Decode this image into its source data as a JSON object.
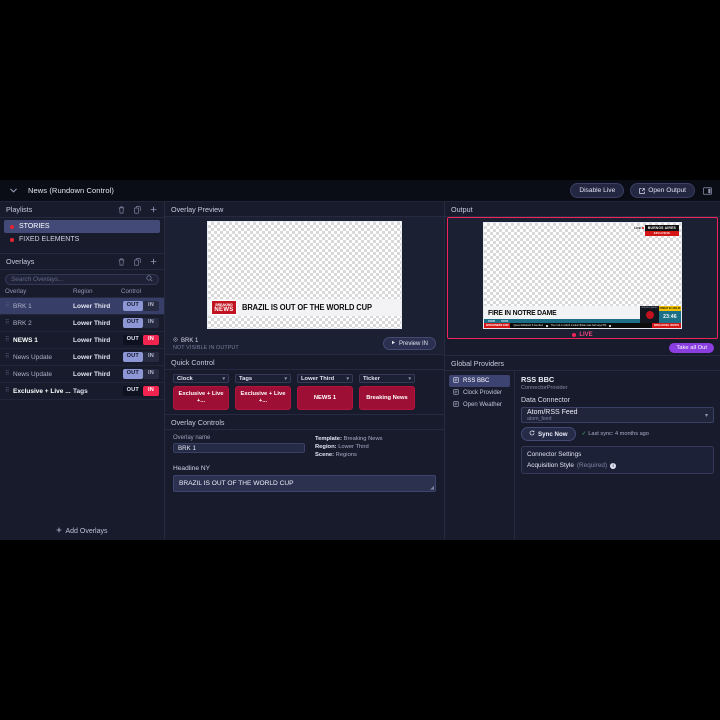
{
  "topbar": {
    "title": "News (Rundown Control)",
    "collapse_icon": "chevron-down-icon",
    "disable_live_label": "Disable Live",
    "open_output_label": "Open Output",
    "open_output_icon": "external-link-icon",
    "layout_icon": "panel-layout-icon"
  },
  "playlists": {
    "title": "Playlists",
    "actions": [
      "trash-icon",
      "duplicate-icon",
      "plus-icon"
    ],
    "items": [
      {
        "label": "STORIES",
        "active": true
      },
      {
        "label": "FIXED ELEMENTS",
        "active": false
      }
    ]
  },
  "overlays": {
    "title": "Overlays",
    "actions": [
      "trash-icon",
      "duplicate-icon",
      "plus-icon"
    ],
    "search_placeholder": "Search Overlays...",
    "search_value": "",
    "search_icon": "search-icon",
    "columns": [
      "Overlay",
      "Region",
      "Control"
    ],
    "out_label": "OUT",
    "in_label": "IN",
    "rows": [
      {
        "name": "BRK 1",
        "region": "Lower Third",
        "state": "out",
        "selected": true,
        "bold": false
      },
      {
        "name": "BRK 2",
        "region": "Lower Third",
        "state": "out",
        "selected": false,
        "bold": false
      },
      {
        "name": "NEWS 1",
        "region": "Lower Third",
        "state": "in",
        "selected": false,
        "bold": true
      },
      {
        "name": "News Update",
        "region": "Lower Third",
        "state": "out",
        "selected": false,
        "bold": false
      },
      {
        "name": "News Update",
        "region": "Lower Third",
        "state": "out",
        "selected": false,
        "bold": false
      },
      {
        "name": "Exclusive + Live ...",
        "region": "Tags",
        "state": "in",
        "selected": false,
        "bold": true
      }
    ],
    "add_label": "Add Overlays",
    "add_icon": "plus-icon"
  },
  "preview": {
    "title": "Overlay Preview",
    "overlay_name": "BRK 1",
    "name_icon": "target-icon",
    "status": "NOT VISIBLE IN OUTPUT",
    "button_label": "Preview IN",
    "button_icon": "play-icon",
    "graphic": {
      "badge_top": "BREAKING",
      "badge_bottom": "NEWS",
      "headline": "BRAZIL IS OUT OF THE WORLD CUP"
    }
  },
  "quick_control": {
    "title": "Quick Control",
    "chevron_icon": "chevron-down-icon",
    "columns": [
      {
        "select": "Clock",
        "button": "Exclusive + Live +..."
      },
      {
        "select": "Tags",
        "button": "Exclusive + Live +..."
      },
      {
        "select": "Lower Third",
        "button": "NEWS 1"
      },
      {
        "select": "Ticker",
        "button": "Breaking News"
      }
    ]
  },
  "overlay_controls": {
    "title": "Overlay Controls",
    "name_label": "Overlay name",
    "name_value": "BRK 1",
    "meta": {
      "template_key": "Template:",
      "template_value": "Breaking News",
      "region_key": "Region:",
      "region_value": "Lower Third",
      "scene_key": "Scene:",
      "scene_value": "Regions"
    },
    "headline_label": "Headline NY",
    "headline_value": "BRAZIL IS OUT OF THE WORLD CUP",
    "resize_icon": "resize-grip-icon"
  },
  "output": {
    "title": "Output",
    "live_label": "LIVE",
    "take_all_out_label": "Take all Out",
    "graphic": {
      "live_tag": "LIVE",
      "location": "BUENOS AIRES",
      "location_sub": "EXCLUSIVE",
      "headline": "FIRE IN NOTRE DAME",
      "sub_left": "PARIS",
      "sub_right": "PARIS",
      "ticker_source": "WORLDNEWS.COM",
      "ticker_items": [
        "Queen Elizabeth II has died",
        "The rock on which modern Britain was built says PM"
      ],
      "ticker_end": "BREAKING NEWS",
      "weather_label": "BUENOS AIRES",
      "date": "FRIDAY 22 JAN 23",
      "clock": "23:46"
    }
  },
  "global_providers": {
    "title": "Global Providers",
    "items": [
      {
        "label": "RSS BBC",
        "icon": "provider-icon",
        "active": true
      },
      {
        "label": "Clock Provider",
        "icon": "provider-icon",
        "active": false
      },
      {
        "label": "Open Weather",
        "icon": "provider-icon",
        "active": false
      }
    ],
    "detail_title": "RSS BBC",
    "detail_subtitle": "ConnectorProvider",
    "data_connector_label": "Data Connector",
    "connector_value": "Atom/RSS Feed",
    "connector_key": "atom_feed",
    "connector_chevron": "chevron-down-icon",
    "sync_label": "Sync Now",
    "sync_icon": "refresh-icon",
    "sync_status": "Last sync: 4 months ago",
    "sync_check_icon": "check-icon",
    "connector_settings_title": "Connector Settings",
    "field_label": "Acquisition Style",
    "field_required": "(Required)",
    "field_info_icon": "info-icon"
  },
  "colors": {
    "accent_red": "#f0245a",
    "accent_purple": "#8b3ee0",
    "out_blue": "#8d97d6",
    "panel_bg": "#171b2c"
  }
}
